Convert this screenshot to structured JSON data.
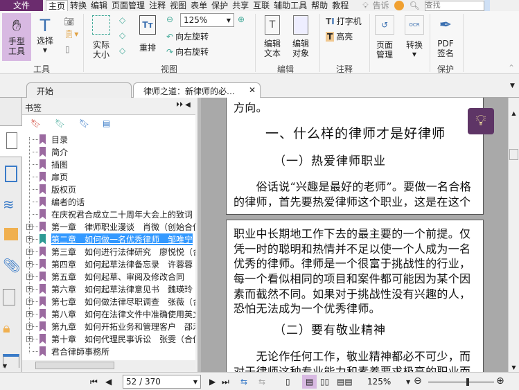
{
  "menu": {
    "file": "文件",
    "items": [
      "主页",
      "转换",
      "编辑",
      "页面管理",
      "注释",
      "视图",
      "表单",
      "保护",
      "共享",
      "互联",
      "辅助工具",
      "帮助",
      "教程"
    ],
    "tell": "告诉",
    "search_placeholder": "查找"
  },
  "ribbon": {
    "hand": "手型\n工具",
    "select": "选择",
    "actual_size": "实际\n大小",
    "reflow": "重排",
    "zoom_value": "125%",
    "rotate_left": "向左旋转",
    "rotate_right": "向右旋转",
    "edit_text": "编辑\n文本",
    "edit_object": "编辑\n对象",
    "typewriter": "打字机",
    "highlight": "高亮",
    "page_manage": "页面\n管理",
    "convert": "转换",
    "pdf_sign": "PDF\n签名",
    "groups": {
      "tools": "工具",
      "view": "视图",
      "edit": "编辑",
      "comment": "注释",
      "protect": "保护"
    }
  },
  "tabs": [
    {
      "label": "开始"
    },
    {
      "label": "律师之道：新律师的必…"
    }
  ],
  "bookmarks": {
    "title": "书签",
    "items": [
      {
        "label": "目录",
        "expand": false
      },
      {
        "label": "简介",
        "expand": false
      },
      {
        "label": "插图",
        "expand": false
      },
      {
        "label": "扉页",
        "expand": false
      },
      {
        "label": "版权页",
        "expand": false
      },
      {
        "label": "编者的话",
        "expand": false
      },
      {
        "label": "在庆祝君合成立二十周年大会上的致词",
        "expand": false
      },
      {
        "label": "第一章　律师职业漫谈　肖微（创始合伙",
        "expand": true
      },
      {
        "label": "第二章　如何做一名优秀律师　邹唯宁",
        "expand": true,
        "selected": true
      },
      {
        "label": "第三章　如何进行法律研究　廖悦悦（合",
        "expand": true
      },
      {
        "label": "第四章　如何起草法律备忘录　许蓉蓉",
        "expand": true
      },
      {
        "label": "第五章　如何起草、审阅及修改合同",
        "expand": true
      },
      {
        "label": "第六章　如何起草法律意见书　魏瑛玲",
        "expand": true
      },
      {
        "label": "第七章　如何做法律尽职调查　张薇（合",
        "expand": true
      },
      {
        "label": "第八章　如何在法律文件中准确使用英文",
        "expand": true
      },
      {
        "label": "第九章　如何开拓业务和管理客户　邵禾",
        "expand": true
      },
      {
        "label": "第十章　如何代理民事诉讼　张雯（合伙",
        "expand": true
      },
      {
        "label": "君合律師事務所",
        "expand": false
      }
    ]
  },
  "document": {
    "page1": [
      "方向。",
      "一、什么样的律师才是好律师",
      "（一）热爱律师职业",
      "　　俗话说“兴趣是最好的老师”。要做一名合格",
      "的律师，首先要热爱律师这个职业，这是在这个"
    ],
    "page2": [
      "职业中长期地工作下去的最主要的一个前提。仅",
      "凭一时的聪明和热情并不足以使一个人成为一名",
      "优秀的律师。律师是一个很富于挑战性的行业，",
      "每一个看似相同的项目和案件都可能因为某个因",
      "素而截然不同。如果对于挑战性没有兴趣的人，",
      "恐怕无法成为一个优秀律师。",
      "（二）要有敬业精神",
      "　　无论作任何工作，敬业精神都必不可少，而",
      "对于律师这种专业能力和素养要求极高的职业而"
    ]
  },
  "status": {
    "page": "52 / 370",
    "zoom": "125%",
    "zoom_slider_percent": 60
  },
  "colors": {
    "accent": "#6b2c6e",
    "selection": "#3399ff",
    "bookmark": "#9b6aa0"
  }
}
